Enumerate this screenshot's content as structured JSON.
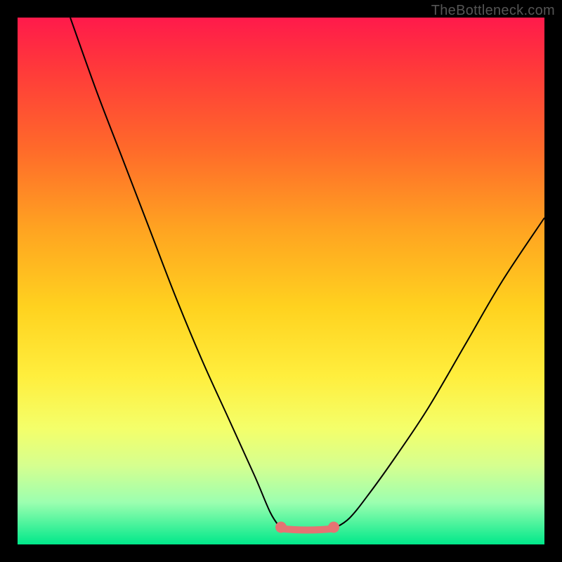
{
  "watermark": "TheBottleneck.com",
  "chart_data": {
    "type": "line",
    "title": "",
    "xlabel": "",
    "ylabel": "",
    "xlim": [
      0,
      100
    ],
    "ylim": [
      0,
      100
    ],
    "series": [
      {
        "name": "left-curve",
        "x": [
          10,
          15,
          20,
          25,
          30,
          35,
          40,
          45,
          48,
          50
        ],
        "y": [
          100,
          86,
          73,
          60,
          47,
          35,
          24,
          13,
          6,
          3
        ]
      },
      {
        "name": "right-curve",
        "x": [
          60,
          63,
          67,
          72,
          78,
          85,
          92,
          100
        ],
        "y": [
          3,
          5,
          10,
          17,
          26,
          38,
          50,
          62
        ]
      },
      {
        "name": "flat-bottom",
        "x": [
          50,
          60
        ],
        "y": [
          3,
          3
        ]
      }
    ],
    "gradient_colors": {
      "top": "#ff1a4b",
      "mid": "#ffd21f",
      "bottom": "#00e88a"
    },
    "flat_segment_color": "#e57373"
  }
}
